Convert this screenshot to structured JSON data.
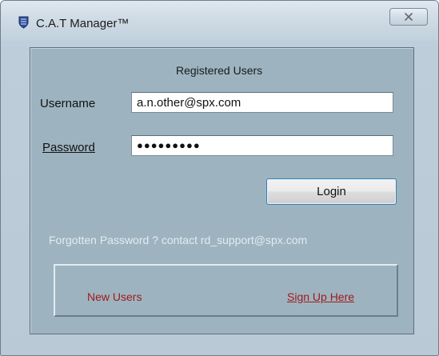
{
  "window": {
    "title": "C.A.T Manager™",
    "app_icon": "shield-icon",
    "close_icon": "close-icon"
  },
  "form": {
    "heading": "Registered Users",
    "username_label": "Username",
    "username_value": "a.n.other@spx.com",
    "password_label": "Password",
    "password_value": "●●●●●●●●●",
    "login_label": "Login",
    "forgot_text": "Forgotten Password ? contact rd_support@spx.com"
  },
  "new_users": {
    "label": "New Users",
    "signup_link": "Sign Up Here"
  },
  "colors": {
    "panel": "#9db4c0",
    "link_red": "#a11a1a",
    "button_border": "#3c7fb1"
  }
}
